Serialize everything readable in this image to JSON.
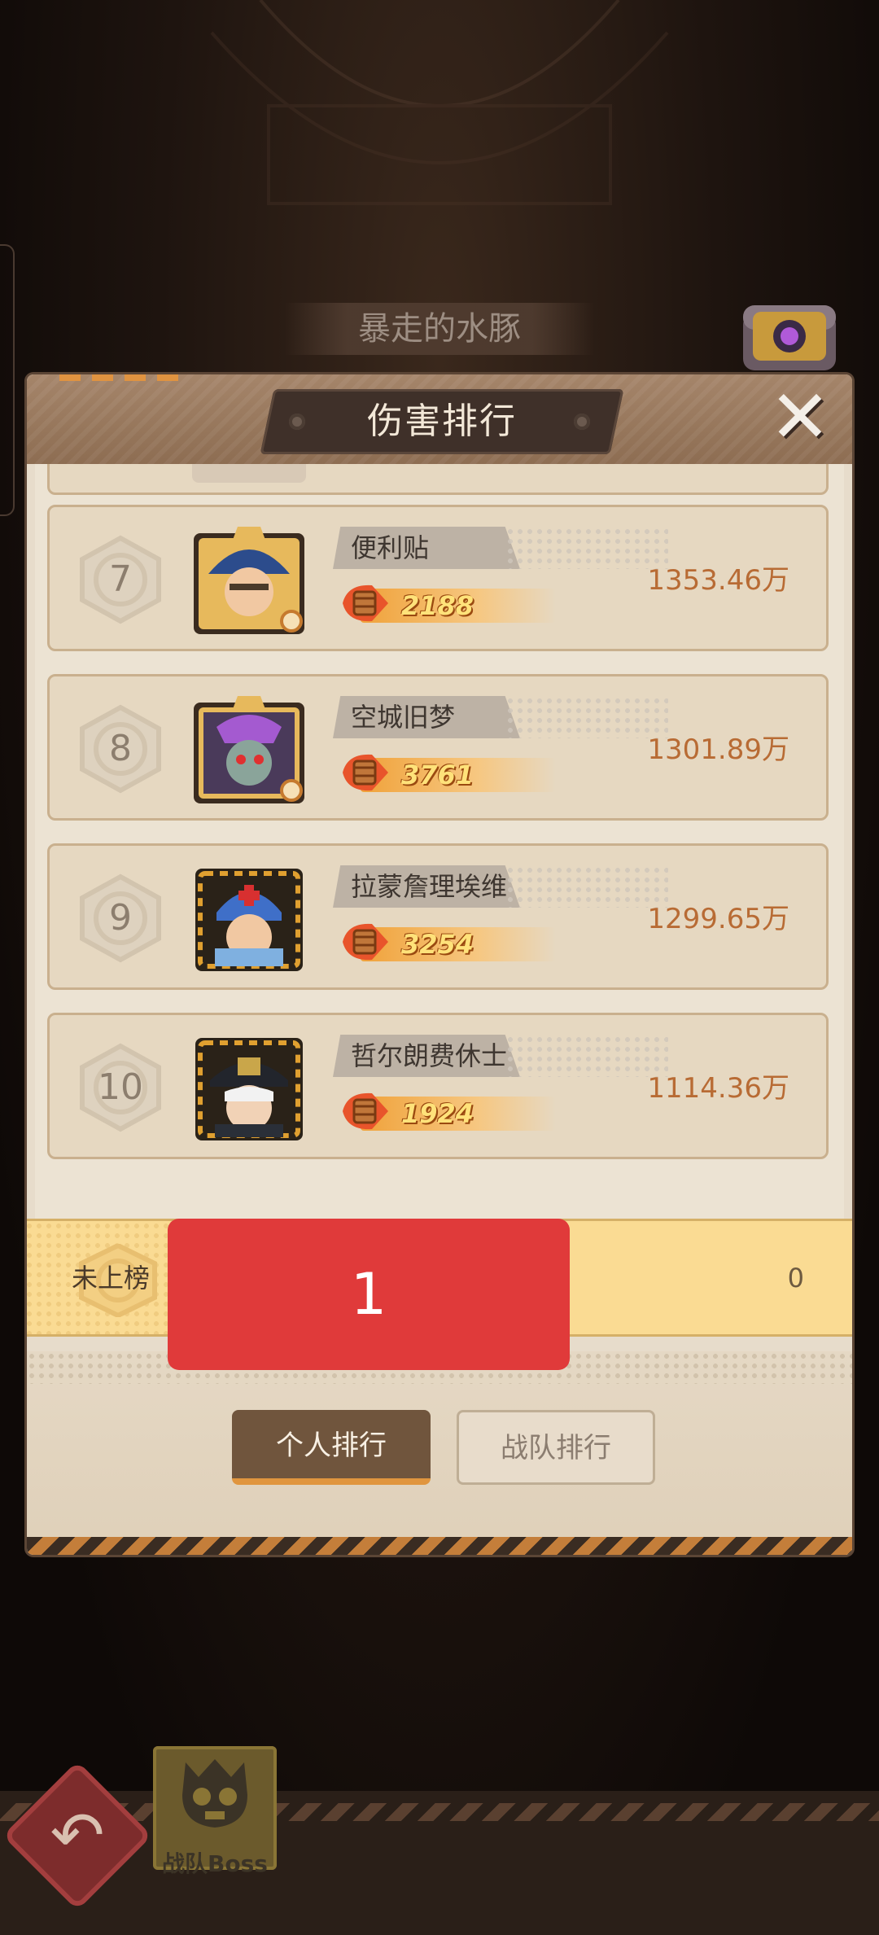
{
  "header": {
    "boss_name": "暴走的水豚"
  },
  "modal": {
    "title": "伤害排行",
    "close_label": "✕"
  },
  "ranking": [
    {
      "rank": "7",
      "name": "便利贴",
      "power": "2188",
      "damage": "1353.46万"
    },
    {
      "rank": "8",
      "name": "空城旧梦",
      "power": "3761",
      "damage": "1301.89万"
    },
    {
      "rank": "9",
      "name": "拉蒙詹理埃维",
      "power": "3254",
      "damage": "1299.65万"
    },
    {
      "rank": "10",
      "name": "哲尔朗费休士",
      "power": "1924",
      "damage": "1114.36万"
    }
  ],
  "my_rank": {
    "status": "未上榜",
    "damage": "0"
  },
  "overlay": {
    "label": "1"
  },
  "tabs": {
    "personal": "个人排行",
    "team": "战队排行"
  },
  "bottom_nav": {
    "team_boss_label": "战队Boss"
  },
  "colors": {
    "accent_orange": "#e0953e",
    "damage_text": "#b86b34",
    "overlay_red": "#e03a3a",
    "my_rank_bg": "#fadb93"
  },
  "icons": {
    "close": "close-icon",
    "back": "back-arrow-icon",
    "power": "bullet-power-icon",
    "rank": "rank-badge-icon",
    "boss": "skull-boss-icon",
    "chest": "treasure-chest-icon"
  }
}
